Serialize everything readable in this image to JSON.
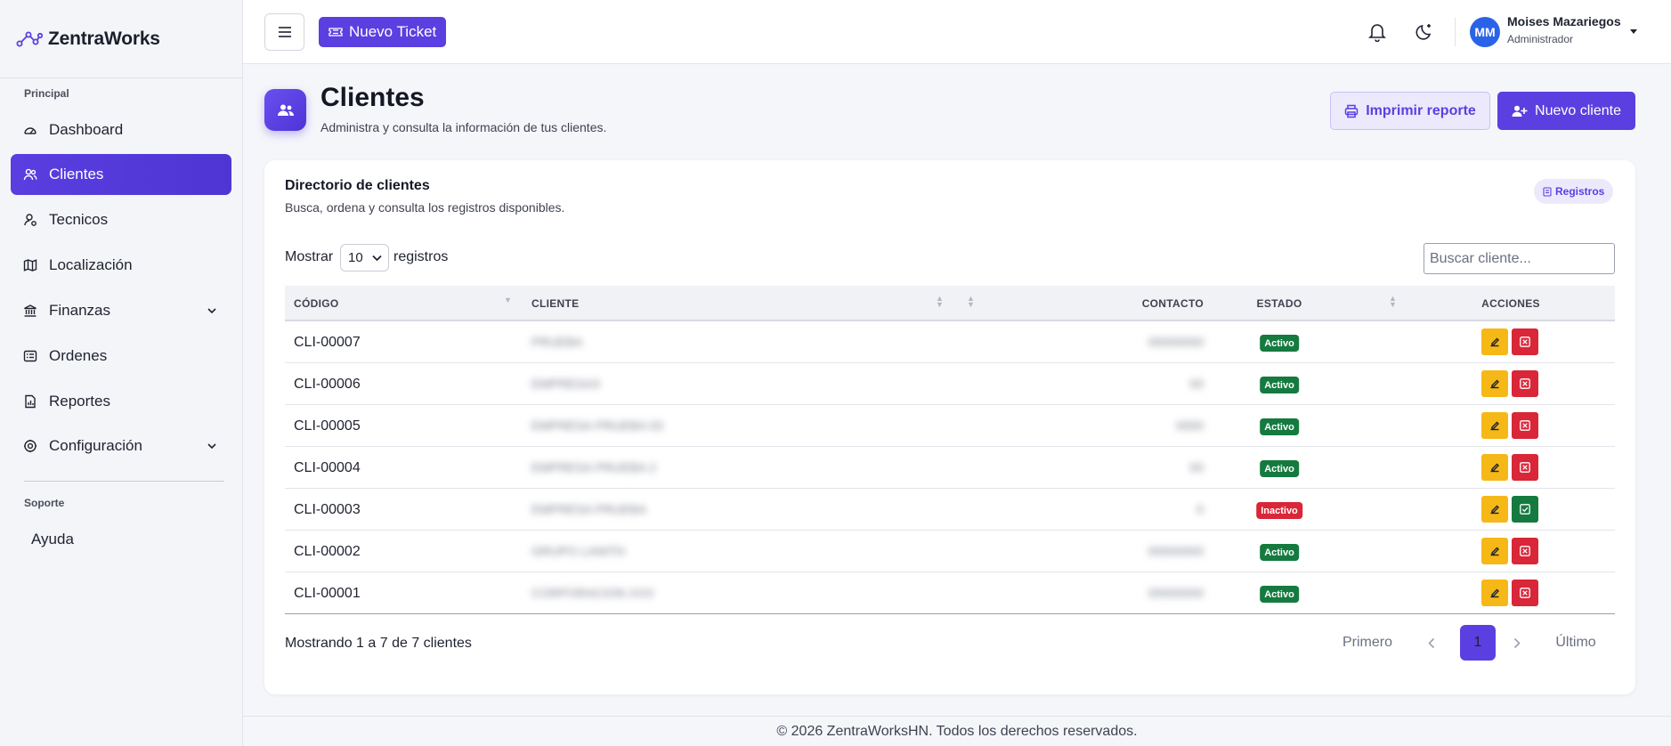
{
  "brand": {
    "name": "ZentraWorks"
  },
  "sidebar": {
    "section_main": "Principal",
    "items": [
      {
        "label": "Dashboard",
        "icon": "gauge-icon"
      },
      {
        "label": "Clientes",
        "icon": "users-icon",
        "active": true
      },
      {
        "label": "Tecnicos",
        "icon": "technician-icon"
      },
      {
        "label": "Localización",
        "icon": "map-icon"
      },
      {
        "label": "Finanzas",
        "icon": "bank-icon",
        "expandable": true
      },
      {
        "label": "Ordenes",
        "icon": "list-icon"
      },
      {
        "label": "Reportes",
        "icon": "report-icon"
      },
      {
        "label": "Configuración",
        "icon": "gear-icon",
        "expandable": true
      }
    ],
    "section_support": "Soporte",
    "help": "Ayuda"
  },
  "topbar": {
    "new_ticket": "Nuevo Ticket",
    "user": {
      "initials": "MM",
      "name": "Moises Mazariegos",
      "role": "Administrador"
    }
  },
  "page": {
    "title": "Clientes",
    "subtitle": "Administra y consulta la información de tus clientes.",
    "print_button": "Imprimir reporte",
    "new_button": "Nuevo cliente"
  },
  "directory": {
    "title": "Directorio de clientes",
    "subtitle": "Busca, ordena y consulta los registros disponibles.",
    "badge": "Registros",
    "show_label": "Mostrar",
    "page_size": "10",
    "records_label": "registros",
    "search_placeholder": "Buscar cliente...",
    "columns": {
      "code": "CÓDIGO",
      "client": "CLIENTE",
      "contact": "CONTACTO",
      "status": "ESTADO",
      "actions": "ACCIONES"
    },
    "rows": [
      {
        "code": "CLI-00007",
        "client": "PRUEBA",
        "contact": "00000000",
        "status": "Activo"
      },
      {
        "code": "CLI-00006",
        "client": "EMPRESAX",
        "contact": "00",
        "status": "Activo"
      },
      {
        "code": "CLI-00005",
        "client": "EMPRESA PRUEBA 03",
        "contact": "0000",
        "status": "Activo"
      },
      {
        "code": "CLI-00004",
        "client": "EMPRESA PRUEBA 2",
        "contact": "00",
        "status": "Activo"
      },
      {
        "code": "CLI-00003",
        "client": "EMPRESA PRUEBA",
        "contact": "0",
        "status": "Inactivo"
      },
      {
        "code": "CLI-00002",
        "client": "GRUPO LANITH",
        "contact": "00000000",
        "status": "Activo"
      },
      {
        "code": "CLI-00001",
        "client": "CORPORACION XXX",
        "contact": "00000000",
        "status": "Activo"
      }
    ],
    "showing": "Mostrando 1 a 7 de 7 clientes",
    "pagination": {
      "first": "Primero",
      "current": "1",
      "last": "Último"
    }
  },
  "footer": "© 2026 ZentraWorksHN. Todos los derechos reservados.",
  "colors": {
    "accent": "#5b3fe0",
    "active": "#157a3f",
    "inactive": "#d92638",
    "edit": "#f5b817"
  }
}
